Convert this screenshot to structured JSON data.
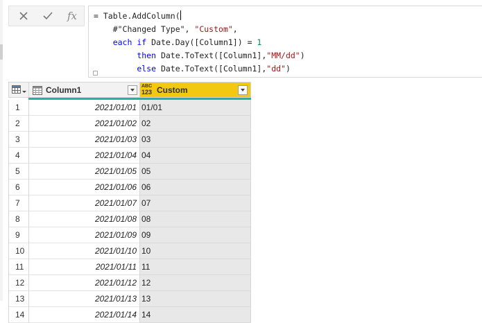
{
  "formula_bar": {
    "cancel_icon": "x-icon",
    "commit_icon": "check-icon",
    "fx_label": "fx",
    "lines": [
      [
        {
          "t": "= Table.AddColumn(",
          "c": "black"
        }
      ],
      [
        {
          "t": "    #\"Changed Type\", ",
          "c": "black"
        },
        {
          "t": "\"Custom\"",
          "c": "str"
        },
        {
          "t": ",",
          "c": "black"
        }
      ],
      [
        {
          "t": "    ",
          "c": "black"
        },
        {
          "t": "each if",
          "c": "kw"
        },
        {
          "t": " Date.Day([Column1]) = ",
          "c": "black"
        },
        {
          "t": "1",
          "c": "num"
        }
      ],
      [
        {
          "t": "         ",
          "c": "black"
        },
        {
          "t": "then",
          "c": "kw"
        },
        {
          "t": " Date.ToText([Column1],",
          "c": "black"
        },
        {
          "t": "\"MM/dd\"",
          "c": "str"
        },
        {
          "t": ")",
          "c": "black"
        }
      ],
      [
        {
          "t": "         ",
          "c": "black"
        },
        {
          "t": "else",
          "c": "kw"
        },
        {
          "t": " Date.ToText([Column1],",
          "c": "black"
        },
        {
          "t": "\"dd\"",
          "c": "str"
        },
        {
          "t": ")",
          "c": "black"
        }
      ]
    ]
  },
  "grid": {
    "corner_icon": "table-menu-icon",
    "columns": [
      {
        "label": "Column1",
        "type_icon": "calendar-type-icon"
      },
      {
        "label": "Custom",
        "type_icon_text_top": "ABC",
        "type_icon_text_bottom": "123"
      }
    ],
    "rows": [
      {
        "index": "1",
        "column1": "2021/01/01",
        "custom": "01/01"
      },
      {
        "index": "2",
        "column1": "2021/01/02",
        "custom": "02"
      },
      {
        "index": "3",
        "column1": "2021/01/03",
        "custom": "03"
      },
      {
        "index": "4",
        "column1": "2021/01/04",
        "custom": "04"
      },
      {
        "index": "5",
        "column1": "2021/01/05",
        "custom": "05"
      },
      {
        "index": "6",
        "column1": "2021/01/06",
        "custom": "06"
      },
      {
        "index": "7",
        "column1": "2021/01/07",
        "custom": "07"
      },
      {
        "index": "8",
        "column1": "2021/01/08",
        "custom": "08"
      },
      {
        "index": "9",
        "column1": "2021/01/09",
        "custom": "09"
      },
      {
        "index": "10",
        "column1": "2021/01/10",
        "custom": "10"
      },
      {
        "index": "11",
        "column1": "2021/01/11",
        "custom": "11"
      },
      {
        "index": "12",
        "column1": "2021/01/12",
        "custom": "12"
      },
      {
        "index": "13",
        "column1": "2021/01/13",
        "custom": "13"
      },
      {
        "index": "14",
        "column1": "2021/01/14",
        "custom": "14"
      }
    ]
  },
  "colors": {
    "custom_header": "#f2c811",
    "quality_bar": "#1bb5a4",
    "custom_cells": "#e8e8e8",
    "string_literal": "#a31515",
    "keyword": "#0000ff",
    "number": "#098658"
  }
}
